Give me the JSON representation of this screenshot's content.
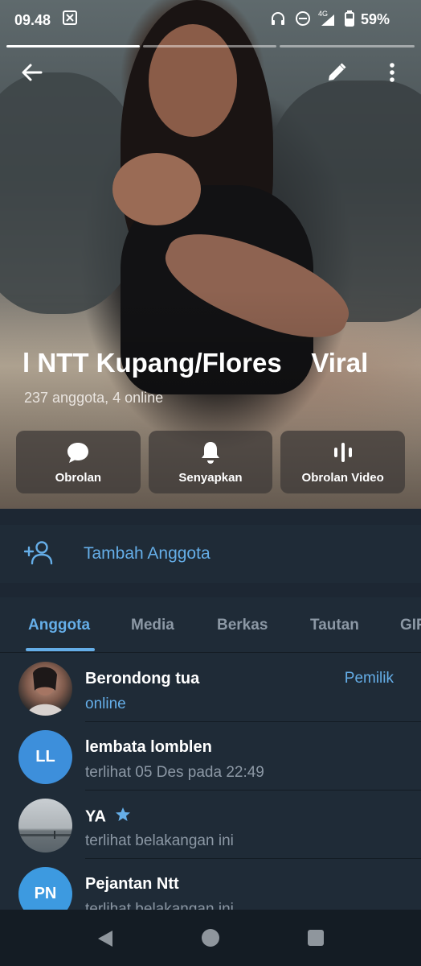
{
  "status_bar": {
    "time": "09.48",
    "network": "4G",
    "battery": "59%"
  },
  "header": {
    "group_title": "l NTT Kupang/Flores    Viral",
    "subtitle": "237 anggota, 4 online"
  },
  "actions": [
    {
      "label": "Obrolan",
      "icon": "chat-bubble-icon"
    },
    {
      "label": "Senyapkan",
      "icon": "bell-icon"
    },
    {
      "label": "Obrolan Video",
      "icon": "voice-chat-icon"
    }
  ],
  "add_member": {
    "label": "Tambah Anggota",
    "icon": "add-person-icon"
  },
  "tabs": [
    {
      "label": "Anggota",
      "active": true
    },
    {
      "label": "Media"
    },
    {
      "label": "Berkas"
    },
    {
      "label": "Tautan"
    },
    {
      "label": "GIF"
    }
  ],
  "members": [
    {
      "name": "Berondong tua",
      "status": "online",
      "role": "Pemilik",
      "avatar_type": "photo"
    },
    {
      "name": "lembata lomblen",
      "status": "terlihat  05 Des pada 22:49",
      "avatar_initials": "LL",
      "avatar_color": "#3d8fdb"
    },
    {
      "name": "YA",
      "status": "terlihat belakangan ini",
      "badge_icon": "star-icon",
      "avatar_type": "photo"
    },
    {
      "name": "Pejantan Ntt",
      "status": "terlihat belakangan ini",
      "avatar_initials": "PN",
      "avatar_color": "#3d9ae0"
    }
  ],
  "colors": {
    "accent": "#65aee8",
    "background": "#1d2733",
    "card": "#1f2b37",
    "muted_text": "#8c98a5"
  }
}
